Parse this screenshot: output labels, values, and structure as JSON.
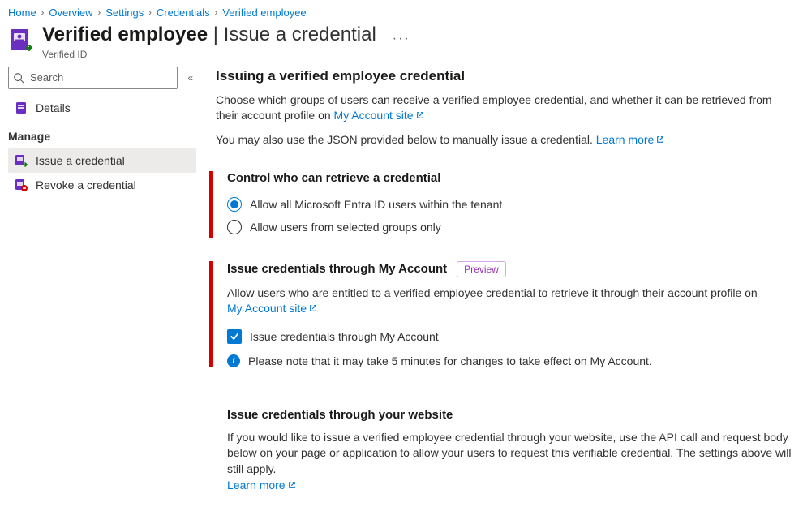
{
  "breadcrumb": {
    "items": [
      "Home",
      "Overview",
      "Settings",
      "Credentials",
      "Verified employee"
    ]
  },
  "header": {
    "title_strong": "Verified employee",
    "title_light": "Issue a credential",
    "subtitle": "Verified ID"
  },
  "sidebar": {
    "search_placeholder": "Search",
    "details": "Details",
    "manage_header": "Manage",
    "issue": "Issue a credential",
    "revoke": "Revoke a credential"
  },
  "content": {
    "intro": {
      "heading": "Issuing a verified employee credential",
      "p1a": "Choose which groups of users can receive a verified employee credential, and whether it can be retrieved from their account profile on ",
      "link1": "My Account site",
      "p2a": "You may also use the JSON provided below to manually issue a credential. ",
      "link2": "Learn more"
    },
    "control": {
      "heading": "Control who can retrieve a credential",
      "opt1": "Allow all Microsoft Entra ID users within the tenant",
      "opt2": "Allow users from selected groups only"
    },
    "myaccount": {
      "heading": "Issue credentials through My Account",
      "badge": "Preview",
      "p1a": "Allow users who are entitled to a verified employee credential to retrieve it through their account profile on",
      "link1": "My Account site",
      "check_label": "Issue credentials through My Account",
      "info": "Please note that it may take 5 minutes for changes to take effect on My Account."
    },
    "website": {
      "heading": "Issue credentials through your website",
      "p1": "If you would like to issue a verified employee credential through your website, use the API call and request body below on your page or application to allow your users to request this verifiable credential. The settings above will still apply.",
      "link1": "Learn more"
    }
  }
}
